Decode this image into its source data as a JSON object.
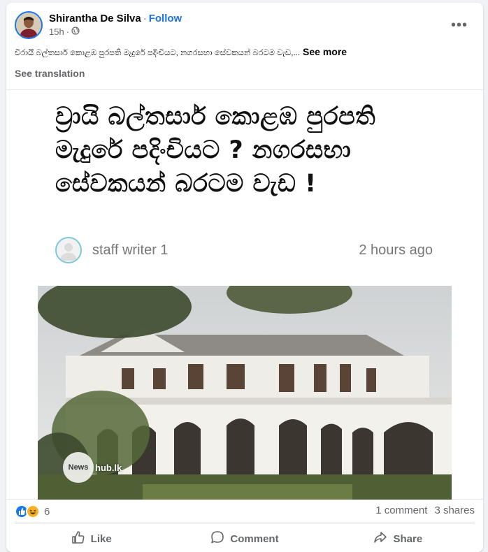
{
  "post": {
    "author": "Shirantha De Silva",
    "separator": "·",
    "follow_label": "Follow",
    "time": "15h",
    "privacy_separator": "·",
    "text": "විරායි බල්තසාර් කොළඹ පුරපති මැදුරේ පදිංචියට, නගරසභා සේවකයන් බරටම වැඩ,...",
    "see_more": "See more",
    "see_translation": "See translation",
    "more_options": "•••"
  },
  "article": {
    "headline": "ව්‍රායි බල්තසාර් කොළඹ පුරපති මැදුරේ පදිංචියට ? නගරසභා සේවකයන් බරටම වැඩ !",
    "writer": "staff writer 1",
    "time_ago": "2 hours ago",
    "watermark_circle": "News",
    "watermark_text": "hub.lk"
  },
  "stats": {
    "reaction_count": "6",
    "comments": "1 comment",
    "shares": "3 shares",
    "reaction_icons": [
      "like-icon",
      "haha-icon"
    ]
  },
  "actions": {
    "like": "Like",
    "comment": "Comment",
    "share": "Share"
  },
  "colors": {
    "accent": "#1b74e4",
    "secondary_text": "#65676b",
    "like_blue": "#1877f2",
    "haha_yellow": "#f7b125"
  }
}
